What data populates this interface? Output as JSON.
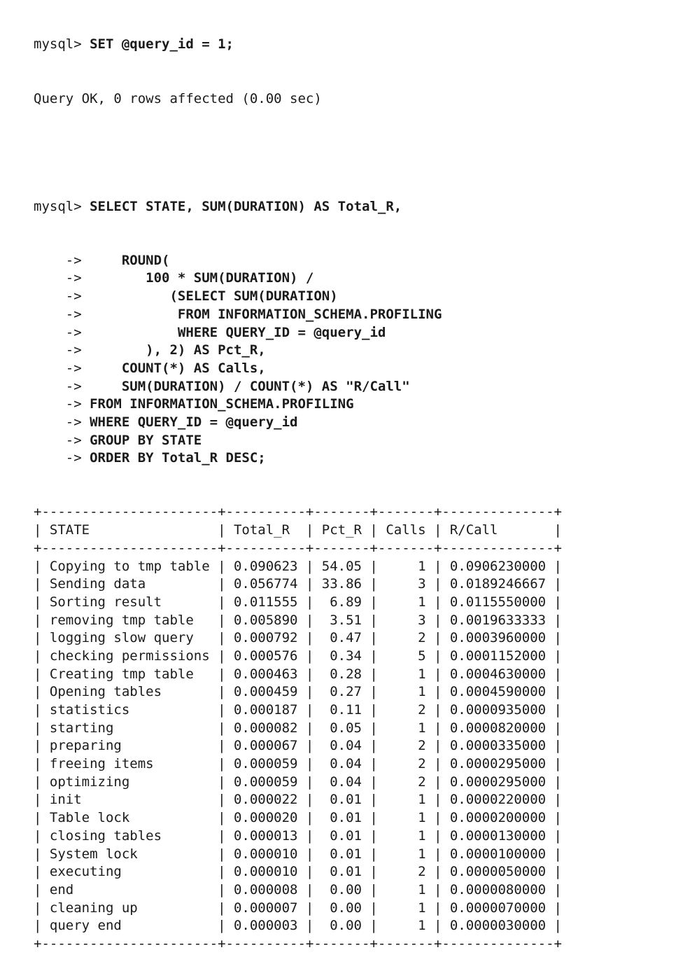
{
  "session": {
    "set_prompt": "mysql> ",
    "set_command": "SET @query_id = 1;",
    "set_result": "Query OK, 0 rows affected (0.00 sec)",
    "query_prompt": "mysql> ",
    "query_lines": [
      {
        "prompt": "    -> ",
        "text": "    ROUND("
      },
      {
        "prompt": "    -> ",
        "text": "       100 * SUM(DURATION) /"
      },
      {
        "prompt": "    -> ",
        "text": "          (SELECT SUM(DURATION)"
      },
      {
        "prompt": "    -> ",
        "text": "           FROM INFORMATION_SCHEMA.PROFILING"
      },
      {
        "prompt": "    -> ",
        "text": "           WHERE QUERY_ID = @query_id"
      },
      {
        "prompt": "    -> ",
        "text": "       ), 2) AS Pct_R,"
      },
      {
        "prompt": "    -> ",
        "text": "    COUNT(*) AS Calls,"
      },
      {
        "prompt": "    -> ",
        "text": "    SUM(DURATION) / COUNT(*) AS \"R/Call\""
      },
      {
        "prompt": "    -> ",
        "text": "FROM INFORMATION_SCHEMA.PROFILING"
      },
      {
        "prompt": "    -> ",
        "text": "WHERE QUERY_ID = @query_id"
      },
      {
        "prompt": "    -> ",
        "text": "GROUP BY STATE"
      },
      {
        "prompt": "    -> ",
        "text": "ORDER BY Total_R DESC;"
      }
    ],
    "query_first_line": "SELECT STATE, SUM(DURATION) AS Total_R,"
  },
  "result_table": {
    "border": "+----------------------+----------+-------+-------+--------------+",
    "header": "| STATE                | Total_R  | Pct_R | Calls | R/Call       |",
    "rows": [
      "| Copying to tmp table | 0.090623 | 54.05 |     1 | 0.0906230000 |",
      "| Sending data         | 0.056774 | 33.86 |     3 | 0.0189246667 |",
      "| Sorting result       | 0.011555 |  6.89 |     1 | 0.0115550000 |",
      "| removing tmp table   | 0.005890 |  3.51 |     3 | 0.0019633333 |",
      "| logging slow query   | 0.000792 |  0.47 |     2 | 0.0003960000 |",
      "| checking permissions | 0.000576 |  0.34 |     5 | 0.0001152000 |",
      "| Creating tmp table   | 0.000463 |  0.28 |     1 | 0.0004630000 |",
      "| Opening tables       | 0.000459 |  0.27 |     1 | 0.0004590000 |",
      "| statistics           | 0.000187 |  0.11 |     2 | 0.0000935000 |",
      "| starting             | 0.000082 |  0.05 |     1 | 0.0000820000 |",
      "| preparing            | 0.000067 |  0.04 |     2 | 0.0000335000 |",
      "| freeing items        | 0.000059 |  0.04 |     2 | 0.0000295000 |",
      "| optimizing           | 0.000059 |  0.04 |     2 | 0.0000295000 |",
      "| init                 | 0.000022 |  0.01 |     1 | 0.0000220000 |",
      "| Table lock           | 0.000020 |  0.01 |     1 | 0.0000200000 |",
      "| closing tables       | 0.000013 |  0.01 |     1 | 0.0000130000 |",
      "| System lock          | 0.000010 |  0.01 |     1 | 0.0000100000 |",
      "| executing            | 0.000010 |  0.01 |     2 | 0.0000050000 |",
      "| end                  | 0.000008 |  0.00 |     1 | 0.0000080000 |",
      "| cleaning up          | 0.000007 |  0.00 |     1 | 0.0000070000 |",
      "| query end            | 0.000003 |  0.00 |     1 | 0.0000030000 |"
    ]
  }
}
